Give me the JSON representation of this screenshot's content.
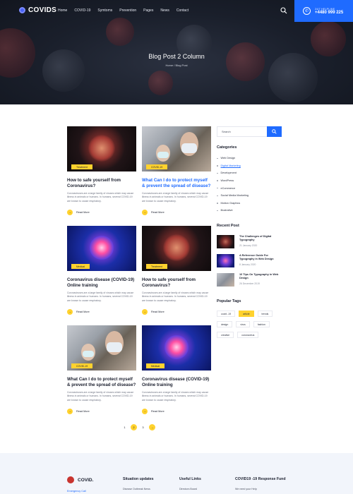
{
  "header": {
    "logo_text": "COVIDS",
    "nav": [
      "Home",
      "COVID-19",
      "Symtoms",
      "Prevention",
      "Pages",
      "News",
      "Contact"
    ],
    "call_label": "24/7 HELPLINE",
    "call_number": "+4480 999 225"
  },
  "hero": {
    "title": "Blog Post 2 Column",
    "breadcrumb": "Home / Blog Post"
  },
  "posts": [
    {
      "badge": "Treatment",
      "title": "How to safe yourself from Coronavirus?",
      "highlight": false,
      "excerpt": "Coronaviruses are a large family of viruses which may cause illness in animals or humans. In humans, several COVID-19 are known to cause respiratory.",
      "read_more": "Read More"
    },
    {
      "badge": "COVID-19",
      "title": "What Can I do to protect myself & prevent the spread of disease?",
      "highlight": true,
      "excerpt": "Coronaviruses are a large family of viruses which may cause illness in animals or humans. In humans, several COVID-19 are known to cause respiratory.",
      "read_more": "Read More"
    },
    {
      "badge": "Medical",
      "title": "Coronavirus disease (COVID-19) Online training",
      "highlight": false,
      "excerpt": "Coronaviruses are a large family of viruses which may cause illness in animals or humans. In humans, several COVID-19 are known to cause respiratory.",
      "read_more": "Read More"
    },
    {
      "badge": "Treatment",
      "title": "How to safe yourself from Coronavirus?",
      "highlight": false,
      "excerpt": "Coronaviruses are a large family of viruses which may cause illness in animals or humans. In humans, several COVID-19 are known to cause respiratory.",
      "read_more": "Read More"
    },
    {
      "badge": "COVID-19",
      "title": "What Can I do to protect myself & prevent the spread of disease?",
      "highlight": false,
      "excerpt": "Coronaviruses are a large family of viruses which may cause illness in animals or humans. In humans, several COVID-19 are known to cause respiratory.",
      "read_more": "Read More"
    },
    {
      "badge": "Medical",
      "title": "Coronavirus disease (COVID-19) Online training",
      "highlight": false,
      "excerpt": "Coronaviruses are a large family of viruses which may cause illness in animals or humans. In humans, several COVID-19 are known to cause respiratory.",
      "read_more": "Read More"
    }
  ],
  "pagination": {
    "pages": [
      "1",
      "2",
      "3"
    ],
    "active": "2",
    "next": "→"
  },
  "sidebar": {
    "search_placeholder": "Search",
    "categories_heading": "Categories",
    "categories": [
      "Web Design",
      "Digital Marketing",
      "Development",
      "WordPress",
      "eCommerce",
      "Social Media Marketing",
      "Motion Graphics",
      "Illustrative"
    ],
    "active_category": "Digital Marketing",
    "recent_heading": "Recent Post",
    "recent": [
      {
        "title": "The Challenges of Digital Typography",
        "date": "21 January 2020"
      },
      {
        "title": "A Reference Guide For Typography in Web Design",
        "date": "8 January 2020"
      },
      {
        "title": "10 Tips On Typography in Web Design",
        "date": "26 December 2019"
      }
    ],
    "tags_heading": "Popular Tags",
    "tags": [
      "covid -19",
      "article",
      "trends",
      "design",
      "virus",
      "fashion",
      "creative",
      "coronavirus"
    ],
    "active_tag": "article"
  },
  "footer": {
    "logo_text": "COVID.",
    "emergency": "Emergency Call",
    "col1_heading": "Situation updates",
    "col1_item": "Disease Outbreak News",
    "col2_heading": "Useful Links",
    "col2_item": "Directors Board",
    "col3_heading": "COVID19 -19 Response Fund",
    "col3_item": "We need your Help"
  },
  "colors": {
    "accent": "#1f6bff",
    "yellow": "#ffd22e",
    "dark": "#1b1f2e"
  }
}
